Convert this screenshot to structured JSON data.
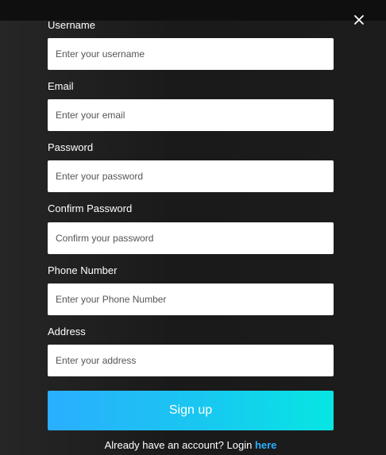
{
  "form": {
    "fields": [
      {
        "label": "Username",
        "placeholder": "Enter your username"
      },
      {
        "label": "Email",
        "placeholder": "Enter your email"
      },
      {
        "label": "Password",
        "placeholder": "Enter your password"
      },
      {
        "label": "Confirm Password",
        "placeholder": "Confirm your password"
      },
      {
        "label": "Phone Number",
        "placeholder": "Enter your Phone Number"
      },
      {
        "label": "Address",
        "placeholder": "Enter your address"
      }
    ],
    "submit_label": "Sign up",
    "login_prompt": "Already have an account? Login",
    "login_link": "here"
  },
  "icons": {
    "close": "close-icon"
  },
  "colors": {
    "accent": "#2aaefe",
    "accent_end": "#07e6e3",
    "background": "#1b1b1b"
  }
}
